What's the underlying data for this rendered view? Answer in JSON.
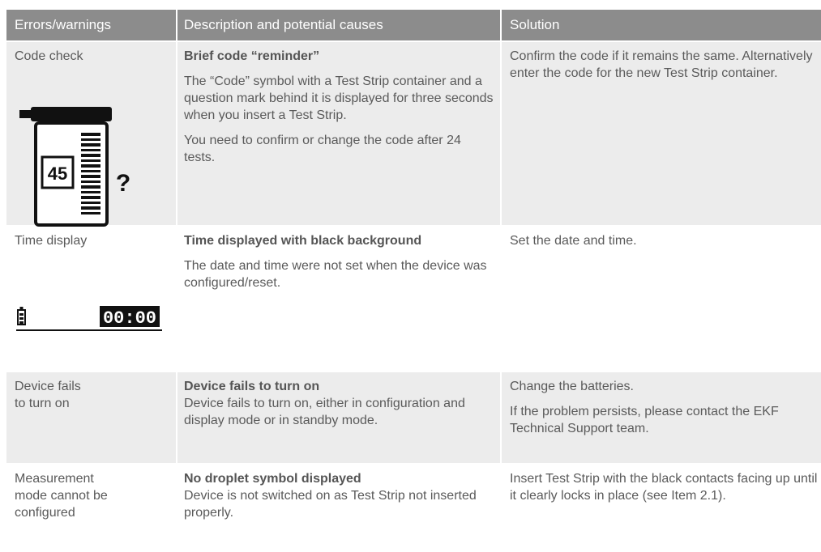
{
  "header": {
    "col1": "Errors/warnings",
    "col2": "Description and potential causes",
    "col3": "Solution"
  },
  "rows": [
    {
      "error": "Code check",
      "desc_title": "Brief code “reminder”",
      "desc_p1": "The “Code” symbol with a Test Strip container and a question mark behind it is displayed for three seconds when you insert a Test Strip.",
      "desc_p2": "You need to confirm or change the code after 24 tests.",
      "solution_p1": "Confirm the code if it remains the same. Alternatively enter the code for the new Test Strip container.",
      "icon": "test-strip-container-code-icon",
      "code_value": "45",
      "symbol": "?"
    },
    {
      "error": "Time display",
      "desc_title": "Time displayed with black background",
      "desc_p1": "The date and time were not set when the device was configured/reset.",
      "solution_p1": "Set the date and time.",
      "icon": "battery-time-display-icon",
      "time_value": "00:00"
    },
    {
      "error_line1": "Device fails",
      "error_line2": "to turn on",
      "desc_title": "Device fails to turn on",
      "desc_p1": "Device fails to turn on, either in configuration and display mode or in standby mode.",
      "solution_p1": "Change the batteries.",
      "solution_p2": "If the problem persists, please contact the EKF Technical Support team."
    },
    {
      "error_line1": "Measurement",
      "error_line2": "mode cannot be",
      "error_line3": "configured",
      "desc_title": "No droplet symbol displayed",
      "desc_p1": "Device is not switched on as Test Strip not inserted properly.",
      "solution_p1": "Insert Test Strip with the black contacts facing up until it clearly locks in place (see Item 2.1)."
    }
  ],
  "colors": {
    "header_bg": "#8c8c8c",
    "row_grey_bg": "#ececec",
    "text": "#5a5a5a"
  }
}
